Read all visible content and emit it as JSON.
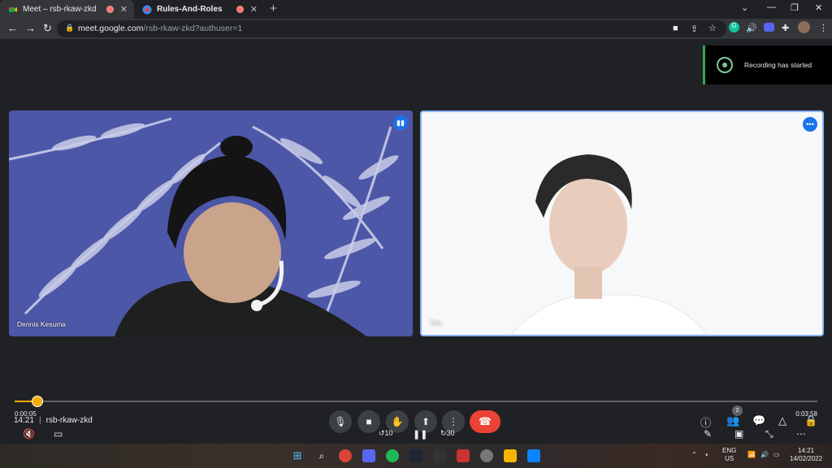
{
  "browser": {
    "tabs": [
      {
        "title": "Meet – rsb-rkaw-zkd",
        "active": true
      },
      {
        "title": "Rules-And-Roles",
        "active": false
      }
    ],
    "url_host": "meet.google.com",
    "url_path": "/rsb-rkaw-zkd?authuser=1"
  },
  "notification": {
    "text": "Recording has started"
  },
  "participants": [
    {
      "name": "Dennis Kesuma"
    },
    {
      "name": "You"
    }
  ],
  "player": {
    "current_time": "0:00:05",
    "duration": "0:03:58",
    "progress": 0.028,
    "rewind_label": "10",
    "forward_label": "30"
  },
  "meeting": {
    "time": "14:21",
    "code": "rsb-rkaw-zkd",
    "participant_count": "2"
  },
  "taskbar": {
    "lang_top": "ENG",
    "lang_bottom": "US",
    "clock_time": "14:21",
    "clock_date": "14/02/2022"
  },
  "colors": {
    "accent": "#f9ab00",
    "hangup": "#ea4335",
    "active_tile_border": "#8ab4f8",
    "recording_green": "#34a853"
  }
}
